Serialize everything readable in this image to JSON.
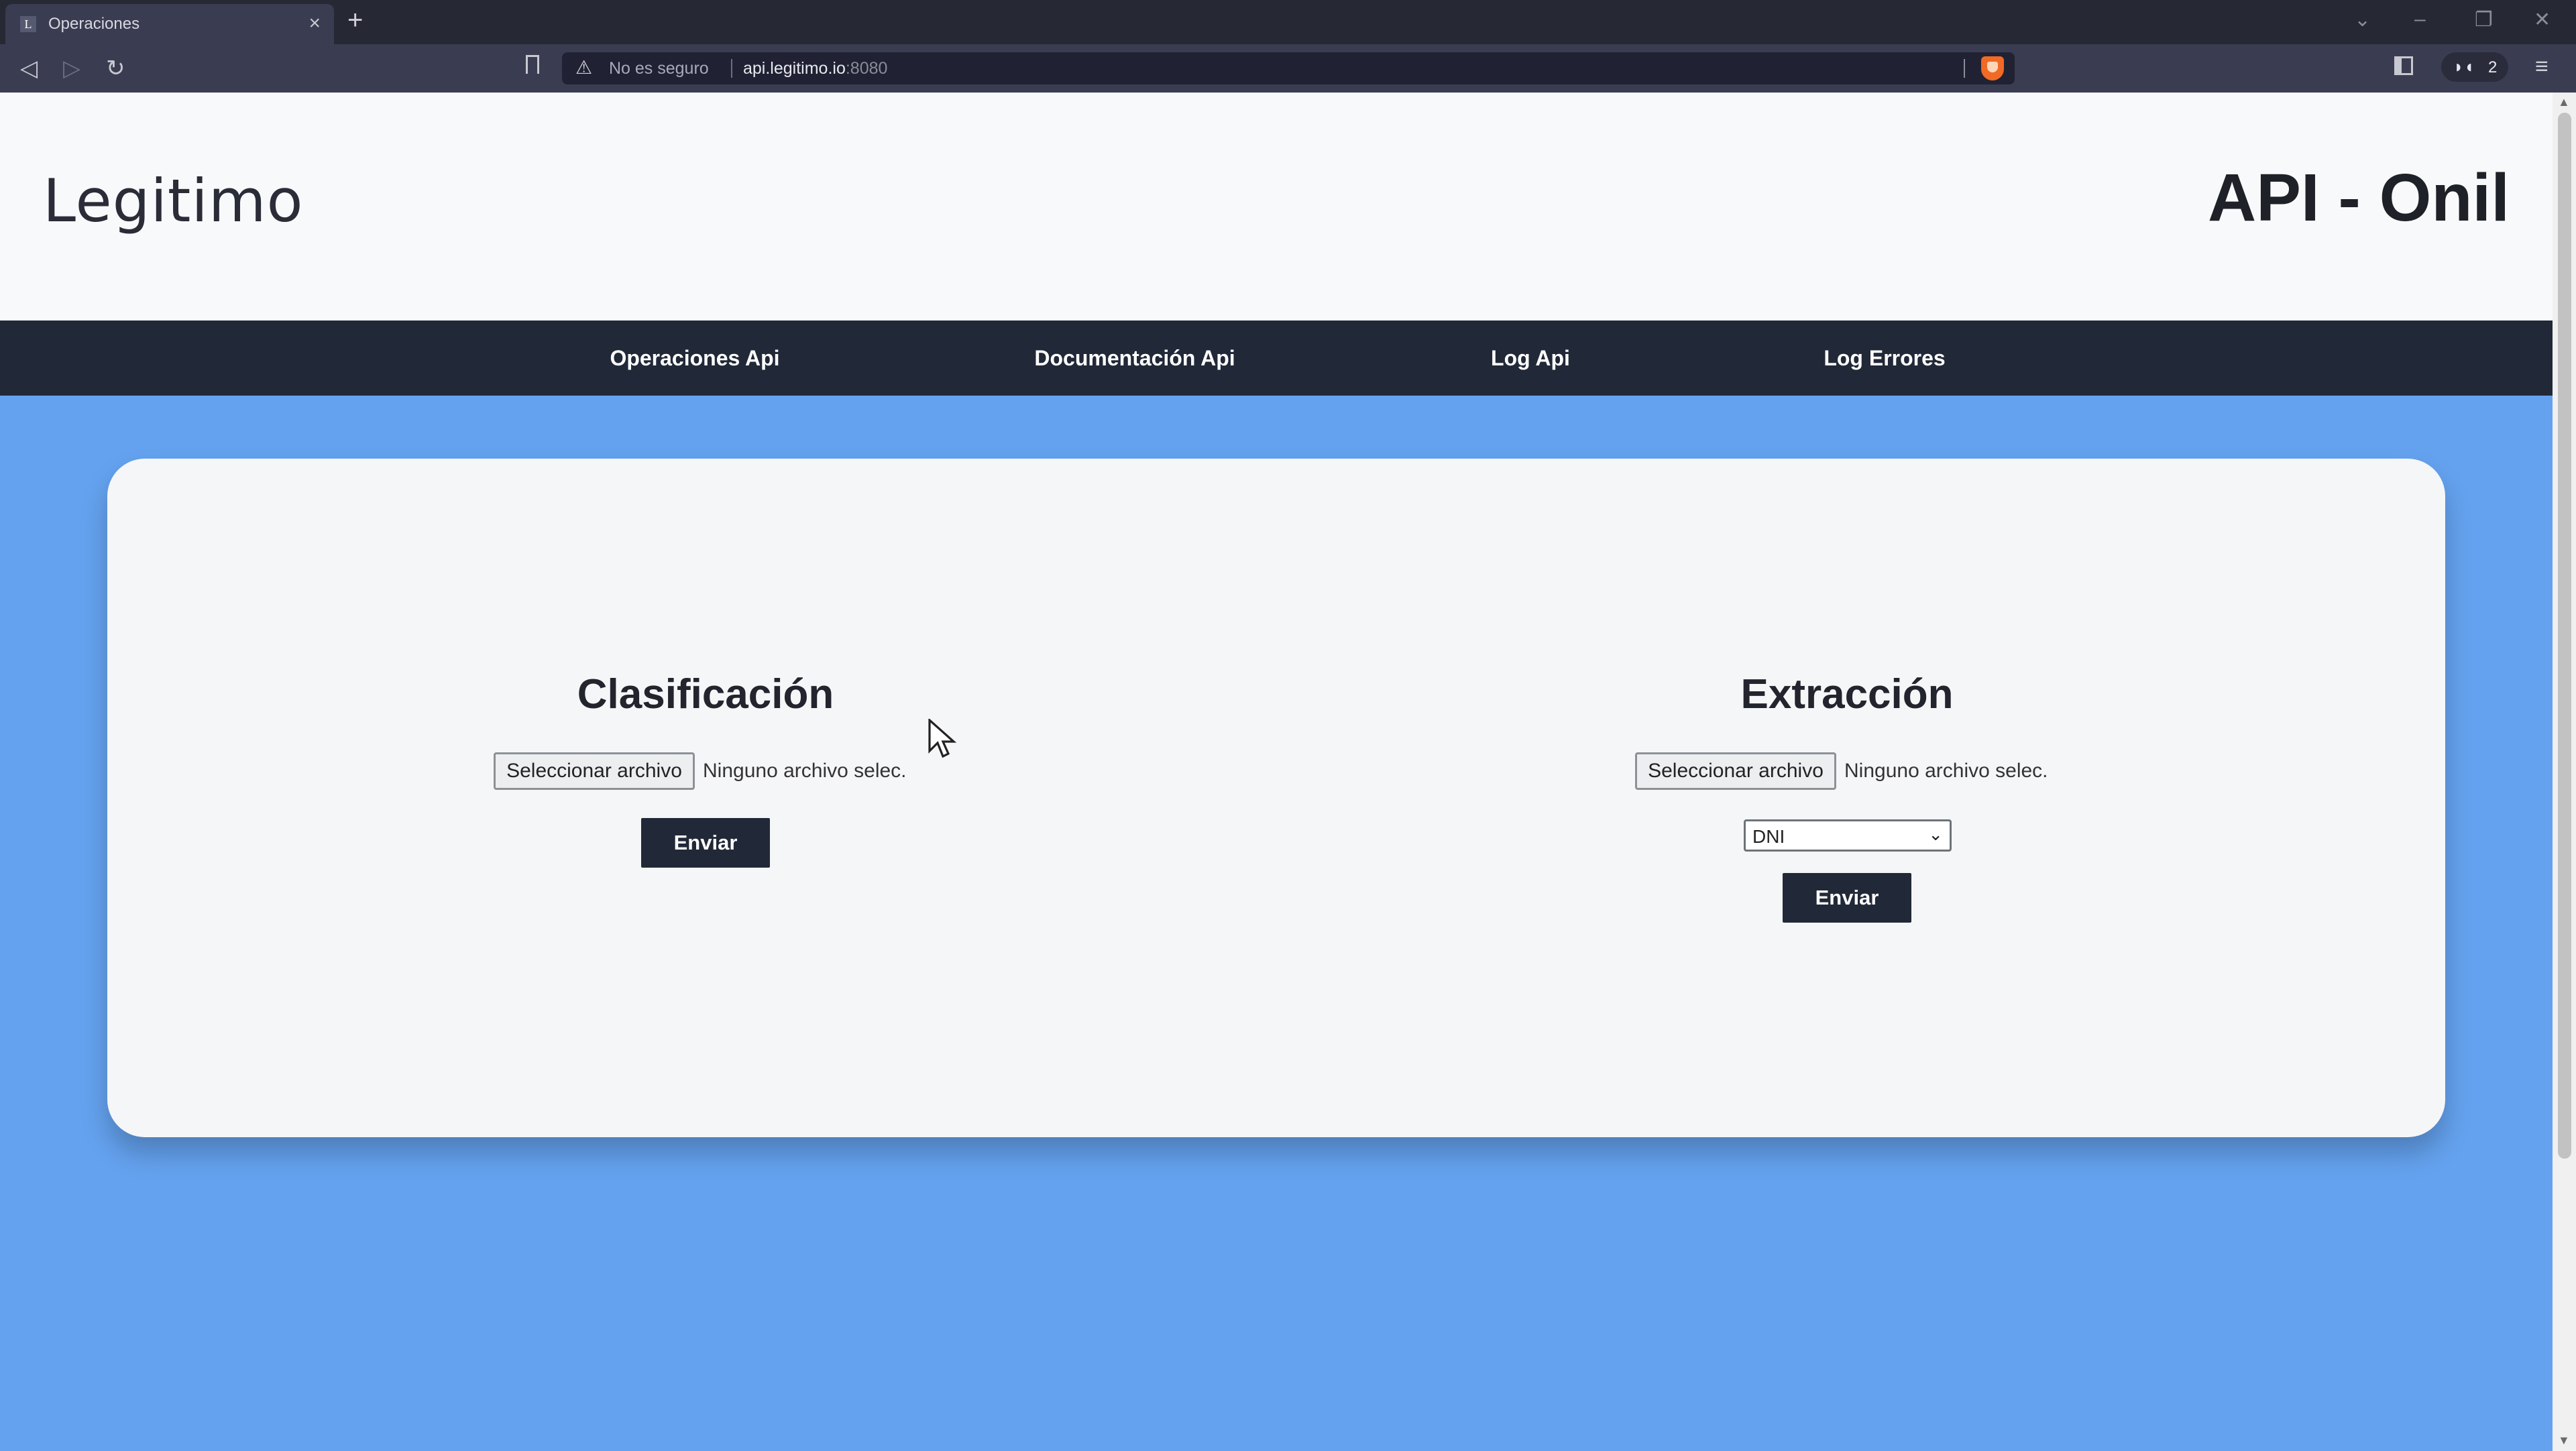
{
  "browser": {
    "tab_title": "Operaciones",
    "tab_close": "×",
    "new_tab": "+",
    "security_label": "No es seguro",
    "url_host": "api.legitimo.io",
    "url_port": ":8080",
    "extension_count": "2"
  },
  "header": {
    "logo_text": "Legitimo",
    "title": "API - Onil"
  },
  "nav": {
    "items": [
      {
        "label": "Operaciones Api"
      },
      {
        "label": "Documentación Api"
      },
      {
        "label": "Log Api"
      },
      {
        "label": "Log Errores"
      }
    ]
  },
  "clasificacion": {
    "title": "Clasificación",
    "file_button": "Seleccionar archivo",
    "file_status": "Ninguno archivo selec.",
    "submit": "Enviar"
  },
  "extraccion": {
    "title": "Extracción",
    "file_button": "Seleccionar archivo",
    "file_status": "Ninguno archivo selec.",
    "document_type": "DNI",
    "submit": "Enviar"
  },
  "colors": {
    "page_background": "#64a2ef",
    "nav_background": "#212837",
    "button_background": "#212837",
    "card_background": "#f5f6f7"
  }
}
